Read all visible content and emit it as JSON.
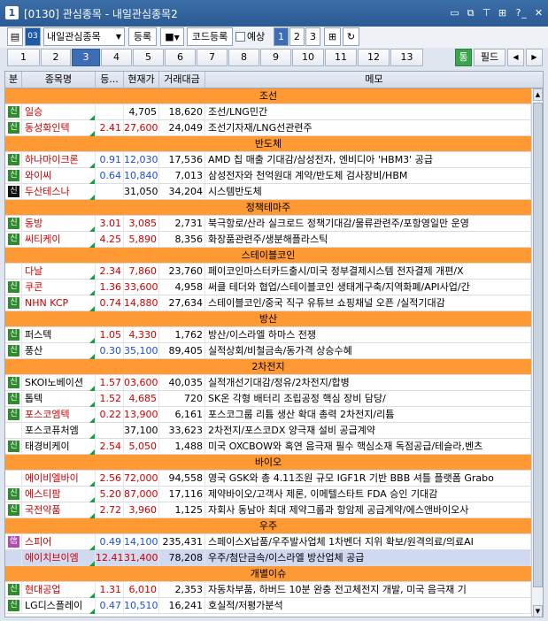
{
  "window": {
    "num": "1",
    "title": "[0130] 관심종목 - 내일관심종목2"
  },
  "toolbar": {
    "group_select": "내일관심종목",
    "register": "등록",
    "code_register": "코드등록",
    "preview": "예상",
    "views": [
      "1",
      "2",
      "3"
    ]
  },
  "tabs": {
    "items": [
      "1",
      "2",
      "3",
      "4",
      "5",
      "6",
      "7",
      "8",
      "9",
      "10",
      "11",
      "12",
      "13"
    ],
    "active": "3",
    "right": [
      "통",
      "필드"
    ]
  },
  "columns": [
    "분",
    "종목명",
    "등...",
    "현재가",
    "거래대금",
    "메모"
  ],
  "rows": [
    {
      "section": "조선"
    },
    {
      "badge": "신",
      "badge_color": "#2e8b2e",
      "name": "일승",
      "name_color": "#cc0000",
      "rate": "",
      "price": "4,705",
      "price_color": "#000000",
      "volume": "18,620",
      "memo": "조선/LNG민간"
    },
    {
      "badge": "신",
      "badge_color": "#2e8b2e",
      "name": "동성화인텍",
      "name_color": "#cc0000",
      "rate": "2.41",
      "rate_color": "#cc0000",
      "price": "27,600",
      "price_color": "#cc0000",
      "volume": "24,049",
      "memo": "조선기자재/LNG선관련주"
    },
    {
      "section": "반도체"
    },
    {
      "badge": "신",
      "badge_color": "#2e8b2e",
      "name": "하나마이크론",
      "name_color": "#cc0000",
      "rate": "0.91",
      "rate_color": "#1f4fd0",
      "price": "12,030",
      "price_color": "#1f4fd0",
      "volume": "17,536",
      "memo": "AMD 칩 매출 기대감/삼성전자, 엔비디아 'HBM3' 공급"
    },
    {
      "badge": "신",
      "badge_color": "#2e8b2e",
      "name": "와이씨",
      "name_color": "#cc0000",
      "rate": "0.64",
      "rate_color": "#1f4fd0",
      "price": "10,840",
      "price_color": "#1f4fd0",
      "volume": "7,013",
      "memo": "삼성전자와 천억원대 계약/반도체 검사장비/HBM"
    },
    {
      "badge": "신",
      "badge_color": "#111111",
      "name": "두산테스나",
      "name_color": "#cc0000",
      "rate": "",
      "price": "31,050",
      "price_color": "#000000",
      "volume": "34,204",
      "memo": "시스템반도체"
    },
    {
      "section": "정책테마주"
    },
    {
      "badge": "신",
      "badge_color": "#2e8b2e",
      "name": "동방",
      "name_color": "#cc0000",
      "rate": "3.01",
      "rate_color": "#cc0000",
      "price": "3,085",
      "price_color": "#cc0000",
      "volume": "2,731",
      "memo": "북극항로/산라 실크로드 정책기대감/물류관련주/포항영일만 운영"
    },
    {
      "badge": "신",
      "badge_color": "#2e8b2e",
      "name": "씨티케이",
      "name_color": "#cc0000",
      "rate": "4.25",
      "rate_color": "#cc0000",
      "price": "5,890",
      "price_color": "#cc0000",
      "volume": "8,356",
      "memo": "화장품관련주/생분해플라스틱"
    },
    {
      "section": "스테이블코인"
    },
    {
      "badge": "",
      "badge_color": "",
      "name": "다날",
      "name_color": "#cc0000",
      "rate": "2.34",
      "rate_color": "#cc0000",
      "price": "7,860",
      "price_color": "#cc0000",
      "volume": "23,760",
      "memo": "페이코인마스터카드출시/미국 정부결제시스템 전자결제 개편/X"
    },
    {
      "badge": "신",
      "badge_color": "#2e8b2e",
      "name": "쿠콘",
      "name_color": "#cc0000",
      "rate": "1.36",
      "rate_color": "#cc0000",
      "price": "33,600",
      "price_color": "#cc0000",
      "volume": "4,958",
      "memo": "써클 테더와 협업/스테이블코인 생태계구축/지역화폐/API사업/간"
    },
    {
      "badge": "신",
      "badge_color": "#2e8b2e",
      "name": "NHN KCP",
      "name_color": "#cc0000",
      "rate": "0.74",
      "rate_color": "#cc0000",
      "price": "14,880",
      "price_color": "#cc0000",
      "volume": "27,634",
      "memo": "스테이블코인/중국 직구 유튜브 쇼핑채널 오픈 /실적기대감"
    },
    {
      "section": "방산"
    },
    {
      "badge": "신",
      "badge_color": "#2e8b2e",
      "name": "퍼스텍",
      "name_color": "#000000",
      "rate": "1.05",
      "rate_color": "#cc0000",
      "price": "4,330",
      "price_color": "#cc0000",
      "volume": "1,762",
      "memo": "방산/이스라엘 하마스 전쟁"
    },
    {
      "badge": "신",
      "badge_color": "#2e8b2e",
      "name": "풍산",
      "name_color": "#000000",
      "rate": "0.30",
      "rate_color": "#1f4fd0",
      "price": "35,100",
      "price_color": "#1f4fd0",
      "volume": "89,405",
      "memo": "실적상회/비철금속/동가격 상승수혜"
    },
    {
      "section": "2차전지"
    },
    {
      "badge": "신",
      "badge_color": "#2e8b2e",
      "name": "SKOI노베이션",
      "name_color": "#000000",
      "rate": "1.57",
      "rate_color": "#cc0000",
      "price": "03,600",
      "price_color": "#cc0000",
      "volume": "40,035",
      "memo": "실적개선기대감/정유/2차전지/합병"
    },
    {
      "badge": "신",
      "badge_color": "#2e8b2e",
      "name": "톱텍",
      "name_color": "#000000",
      "rate": "1.52",
      "rate_color": "#cc0000",
      "price": "4,685",
      "price_color": "#cc0000",
      "volume": "720",
      "memo": "SK온 각형 배터리 조립공정 핵심 장비 담당/"
    },
    {
      "badge": "신",
      "badge_color": "#2e8b2e",
      "name": "포스코엠텍",
      "name_color": "#cc0000",
      "rate": "0.22",
      "rate_color": "#cc0000",
      "price": "13,900",
      "price_color": "#cc0000",
      "volume": "6,161",
      "memo": "포스코그룹 리튬 생산 확대 총력 2차전지/리튬"
    },
    {
      "badge": "",
      "badge_color": "",
      "name": "포스코퓨처엠",
      "name_color": "#000000",
      "rate": "",
      "price": "37,100",
      "price_color": "#000000",
      "volume": "33,623",
      "memo": "2차전지/포스코DX 양극재 설비 공급계약"
    },
    {
      "badge": "신",
      "badge_color": "#2e8b2e",
      "name": "태경비케이",
      "name_color": "#000000",
      "rate": "2.54",
      "rate_color": "#cc0000",
      "price": "5,050",
      "price_color": "#cc0000",
      "volume": "1,488",
      "memo": "미국 OXCBOW와 혹연 음극재 필수 핵심소재 독점공급/테슬라,벤츠"
    },
    {
      "section": "바이오"
    },
    {
      "badge": "",
      "badge_color": "",
      "name": "에이비엘바이",
      "name_color": "#cc0000",
      "rate": "2.56",
      "rate_color": "#cc0000",
      "price": "72,000",
      "price_color": "#cc0000",
      "volume": "94,558",
      "memo": "영국 GSK와 총 4.11조원 규모 IGF1R 기반 BBB 셔틀 플랫폼 Grabo"
    },
    {
      "badge": "신",
      "badge_color": "#2e8b2e",
      "name": "에스티팜",
      "name_color": "#cc0000",
      "rate": "5.20",
      "rate_color": "#cc0000",
      "price": "87,000",
      "price_color": "#cc0000",
      "volume": "17,116",
      "memo": "제약바이오/고객사 제론, 이메텔스타트 FDA 승인 기대감"
    },
    {
      "badge": "신",
      "badge_color": "#2e8b2e",
      "name": "국전약품",
      "name_color": "#cc0000",
      "rate": "2.72",
      "rate_color": "#cc0000",
      "price": "3,960",
      "price_color": "#cc0000",
      "volume": "1,125",
      "memo": "자회사 동남아 최대 제약그룹과 항암제 공급계약/에스앤바이오사"
    },
    {
      "section": "우주"
    },
    {
      "badge": "信",
      "badge_color": "#b04bb0",
      "name": "스피어",
      "name_color": "#cc0000",
      "rate": "0.49",
      "rate_color": "#1f4fd0",
      "price": "14,100",
      "price_color": "#1f4fd0",
      "volume": "235,431",
      "memo": "스페이스X납품/우주발사업체 1차벤더 지위 확보/원격의료/의료AI"
    },
    {
      "badge": "",
      "badge_color": "",
      "name": "에이치브이엠",
      "name_color": "#cc0000",
      "rate": "12.41",
      "rate_color": "#cc0000",
      "price": "31,400",
      "price_color": "#cc0000",
      "volume": "78,208",
      "memo": "우주/첨단금속/이스라엘 방산업체 공급",
      "highlight": true
    },
    {
      "section": "개별이슈"
    },
    {
      "badge": "신",
      "badge_color": "#2e8b2e",
      "name": "현대공업",
      "name_color": "#cc0000",
      "rate": "1.31",
      "rate_color": "#cc0000",
      "price": "6,010",
      "price_color": "#cc0000",
      "volume": "2,353",
      "memo": "자동차부품, 하버드 10분 완충 전고체전지 개발, 미국 음극재 기"
    },
    {
      "badge": "신",
      "badge_color": "#2e8b2e",
      "name": "LG디스플레이",
      "name_color": "#000000",
      "rate": "0.47",
      "rate_color": "#1f4fd0",
      "price": "10,510",
      "price_color": "#1f4fd0",
      "volume": "16,241",
      "memo": "호실적/저평가분석"
    }
  ]
}
